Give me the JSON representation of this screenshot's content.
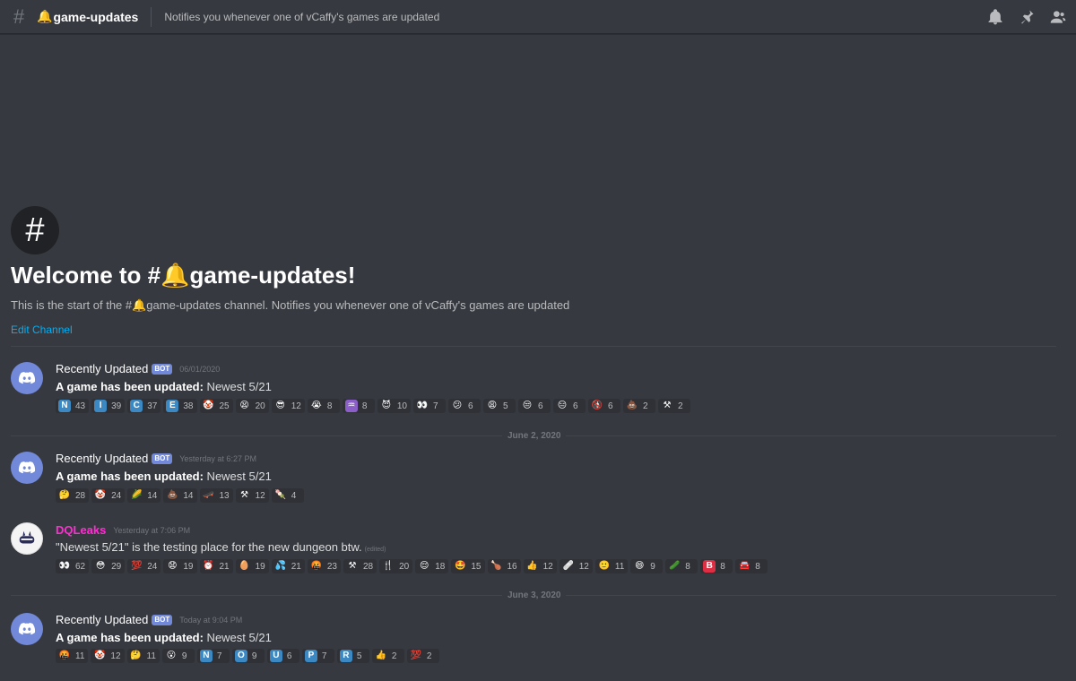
{
  "header": {
    "channel_name": "game-updates",
    "topic": "Notifies you whenever one of vCaffy's games are updated"
  },
  "welcome": {
    "title": "Welcome to #🔔game-updates!",
    "description": "This is the start of the #🔔game-updates channel. Notifies you whenever one of vCaffy's games are updated",
    "edit_link": "Edit Channel"
  },
  "dates": {
    "sep1": "June 2, 2020",
    "sep2": "June 3, 2020"
  },
  "messages": [
    {
      "user": "Recently Updated",
      "bot_tag": "BOT",
      "time": "06/01/2020",
      "bold": "A game has been updated:",
      "text": " Newest 5/21",
      "reactions": [
        {
          "e": "N",
          "c": "43",
          "bg": "#3b88c3"
        },
        {
          "e": "I",
          "c": "39",
          "bg": "#3b88c3"
        },
        {
          "e": "C",
          "c": "37",
          "bg": "#3b88c3"
        },
        {
          "e": "E",
          "c": "38",
          "bg": "#3b88c3"
        },
        {
          "e": "🤡",
          "c": "25"
        },
        {
          "e": "😫",
          "c": "20"
        },
        {
          "e": "😎",
          "c": "12"
        },
        {
          "e": "😭",
          "c": "8"
        },
        {
          "e": "♒",
          "c": "8",
          "bg": "#8b5fc7"
        },
        {
          "e": "😈",
          "c": "10"
        },
        {
          "e": "👀",
          "c": "7"
        },
        {
          "e": "😕",
          "c": "6"
        },
        {
          "e": "😩",
          "c": "5"
        },
        {
          "e": "😒",
          "c": "6"
        },
        {
          "e": "😑",
          "c": "6"
        },
        {
          "e": "🚯",
          "c": "6"
        },
        {
          "e": "💩",
          "c": "2"
        },
        {
          "e": "⚒",
          "c": "2"
        }
      ]
    },
    {
      "user": "Recently Updated",
      "bot_tag": "BOT",
      "time": "Yesterday at 6:27 PM",
      "bold": "A game has been updated:",
      "text": " Newest 5/21",
      "reactions": [
        {
          "e": "🤔",
          "c": "28"
        },
        {
          "e": "🤡",
          "c": "24"
        },
        {
          "e": "🌽",
          "c": "14"
        },
        {
          "e": "💩",
          "c": "14"
        },
        {
          "e": "🛹",
          "c": "13"
        },
        {
          "e": "⚒",
          "c": "12"
        },
        {
          "e": "🍡",
          "c": "4"
        }
      ]
    },
    {
      "user": "DQLeaks",
      "time": "Yesterday at 7:06 PM",
      "text": "\"Newest 5/21\" is the testing place for the new dungeon btw.",
      "edited": "(edited)",
      "reactions": [
        {
          "e": "👀",
          "c": "62"
        },
        {
          "e": "😳",
          "c": "29"
        },
        {
          "e": "💯",
          "c": "24"
        },
        {
          "e": "😧",
          "c": "19"
        },
        {
          "e": "⏰",
          "c": "21"
        },
        {
          "e": "🥚",
          "c": "19"
        },
        {
          "e": "💦",
          "c": "21"
        },
        {
          "e": "🤬",
          "c": "23"
        },
        {
          "e": "⚒",
          "c": "28"
        },
        {
          "e": "🍴",
          "c": "20"
        },
        {
          "e": "😌",
          "c": "18"
        },
        {
          "e": "🤩",
          "c": "15"
        },
        {
          "e": "🍗",
          "c": "16"
        },
        {
          "e": "👍",
          "c": "12"
        },
        {
          "e": "🩹",
          "c": "12"
        },
        {
          "e": "🙂",
          "c": "11"
        },
        {
          "e": "😄",
          "c": "9"
        },
        {
          "e": "🥒",
          "c": "8"
        },
        {
          "e": "B",
          "c": "8",
          "bg": "#dd2e44"
        },
        {
          "e": "🚘",
          "c": "8"
        }
      ]
    },
    {
      "user": "Recently Updated",
      "bot_tag": "BOT",
      "time": "Today at 9:04 PM",
      "bold": "A game has been updated:",
      "text": " Newest 5/21",
      "reactions": [
        {
          "e": "🤬",
          "c": "11"
        },
        {
          "e": "🤡",
          "c": "12"
        },
        {
          "e": "🤔",
          "c": "11"
        },
        {
          "e": "😮",
          "c": "9"
        },
        {
          "e": "N",
          "c": "7",
          "bg": "#3b88c3"
        },
        {
          "e": "O",
          "c": "9",
          "bg": "#3b88c3"
        },
        {
          "e": "U",
          "c": "6",
          "bg": "#3b88c3"
        },
        {
          "e": "P",
          "c": "7",
          "bg": "#3b88c3"
        },
        {
          "e": "R",
          "c": "5",
          "bg": "#3b88c3"
        },
        {
          "e": "👍",
          "c": "2"
        },
        {
          "e": "💯",
          "c": "2"
        }
      ]
    }
  ]
}
